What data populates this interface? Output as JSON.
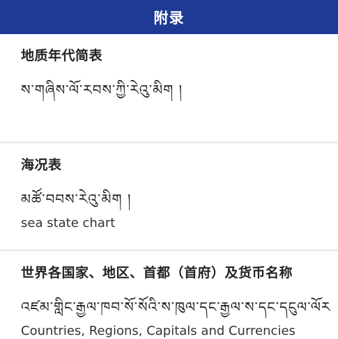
{
  "header": {
    "title": "附录"
  },
  "entries": [
    {
      "title_zh": "地质年代简表",
      "title_bo": "ས་གཞིས་ལོ་རབས་ཀྱི་རེའུ་མིག །",
      "title_en": ""
    },
    {
      "title_zh": "海况表",
      "title_bo": "མཚོ་བབས་རེའུ་མིག །",
      "title_en": "sea state chart"
    },
    {
      "title_zh": "世界各国家、地区、首都（首府）及货币名称",
      "title_bo": "འཛམ་གླིང་རྒྱལ་ཁབ་སོ་སོའི་ས་ཁུལ་དང་རྒྱལ་ས་དང་དངུལ་ལོར",
      "title_en": "Countries, Regions, Capitals and Currencies"
    }
  ]
}
